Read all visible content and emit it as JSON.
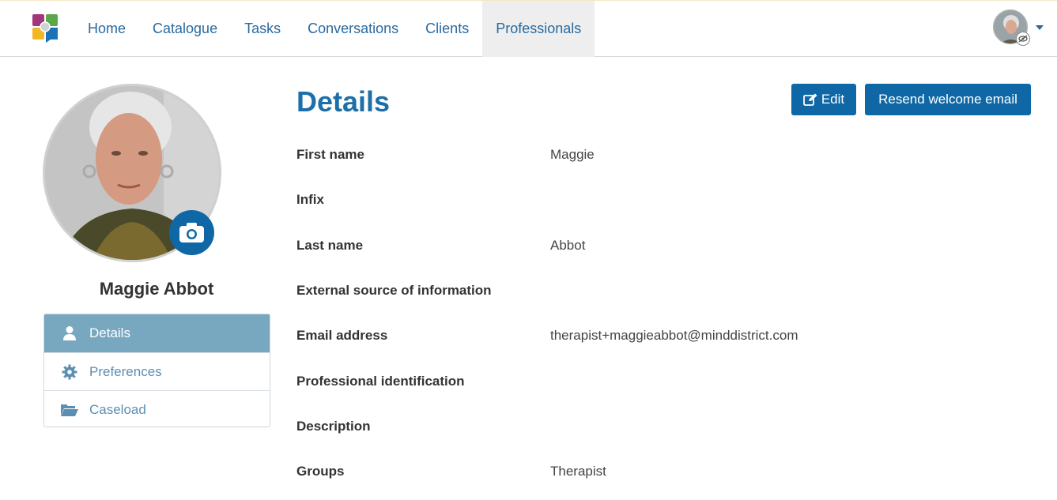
{
  "nav": {
    "items": [
      {
        "label": "Home"
      },
      {
        "label": "Catalogue"
      },
      {
        "label": "Tasks"
      },
      {
        "label": "Conversations"
      },
      {
        "label": "Clients"
      },
      {
        "label": "Professionals",
        "active": true
      }
    ]
  },
  "profile": {
    "name": "Maggie Abbot"
  },
  "side_menu": {
    "items": [
      {
        "label": "Details",
        "icon": "user-icon",
        "active": true
      },
      {
        "label": "Preferences",
        "icon": "gear-icon"
      },
      {
        "label": "Caseload",
        "icon": "folder-open-icon"
      }
    ]
  },
  "main": {
    "title": "Details",
    "edit_label": "Edit",
    "resend_label": "Resend welcome email",
    "fields": [
      {
        "label": "First name",
        "value": "Maggie"
      },
      {
        "label": "Infix",
        "value": ""
      },
      {
        "label": "Last name",
        "value": "Abbot"
      },
      {
        "label": "External source of information",
        "value": ""
      },
      {
        "label": "Email address",
        "value": "therapist+maggieabbot@minddistrict.com"
      },
      {
        "label": "Professional identification",
        "value": ""
      },
      {
        "label": "Description",
        "value": ""
      },
      {
        "label": "Groups",
        "value": "Therapist"
      }
    ]
  },
  "colors": {
    "brand_blue": "#0f68a5",
    "nav_text": "#2a6a9e",
    "side_active": "#78a7c0"
  }
}
